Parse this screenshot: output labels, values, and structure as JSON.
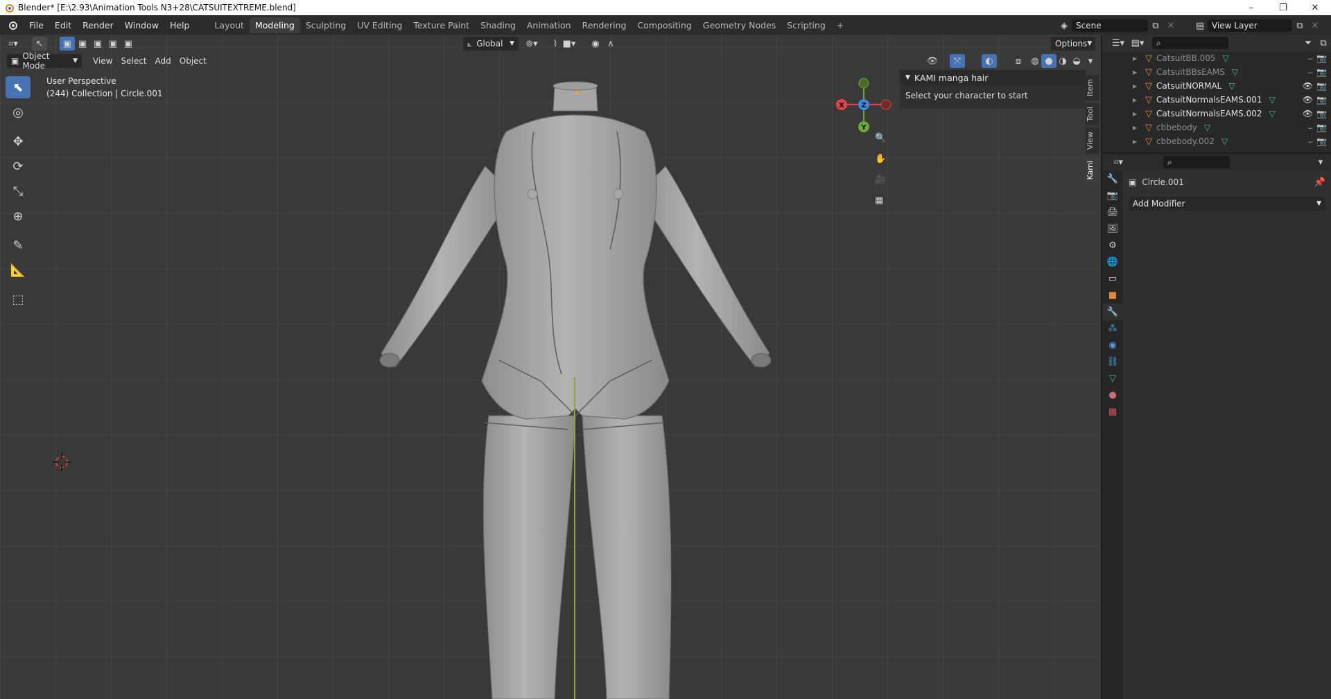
{
  "window": {
    "title": "Blender* [E:\\2.93\\Animation Tools N3+28\\CATSUITEXTREME.blend]",
    "controls": [
      "–",
      "❐",
      "✕"
    ]
  },
  "menu": [
    "File",
    "Edit",
    "Render",
    "Window",
    "Help"
  ],
  "workspaces": [
    {
      "label": "Layout",
      "active": false
    },
    {
      "label": "Modeling",
      "active": true
    },
    {
      "label": "Sculpting",
      "active": false
    },
    {
      "label": "UV Editing",
      "active": false
    },
    {
      "label": "Texture Paint",
      "active": false
    },
    {
      "label": "Shading",
      "active": false
    },
    {
      "label": "Animation",
      "active": false
    },
    {
      "label": "Rendering",
      "active": false
    },
    {
      "label": "Compositing",
      "active": false
    },
    {
      "label": "Geometry Nodes",
      "active": false
    },
    {
      "label": "Scripting",
      "active": false
    }
  ],
  "add_workspace": "+",
  "scene": {
    "label": "Scene"
  },
  "view_layer": {
    "label": "View Layer"
  },
  "viewport_header": {
    "transform_orientation": "Global",
    "options": "Options",
    "mode": "Object Mode",
    "menus": [
      "View",
      "Select",
      "Add",
      "Object"
    ]
  },
  "viewport_info": {
    "line1": "User Perspective",
    "line2": "(244) Collection | Circle.001"
  },
  "gizmo": {
    "x": "X",
    "y": "Y",
    "z": "Z"
  },
  "kami_panel": {
    "title": "KAMI manga hair",
    "body": "Select your character to start"
  },
  "side_tabs": [
    "Item",
    "Tool",
    "View",
    "Kami"
  ],
  "outliner": {
    "rows": [
      {
        "name": "CatsuitBB.005",
        "visible": false
      },
      {
        "name": "CatsuitBBsEAMS",
        "visible": false
      },
      {
        "name": "CatsuitNORMAL",
        "visible": true
      },
      {
        "name": "CatsuitNormalsEAMS.001",
        "visible": true
      },
      {
        "name": "CatsuitNormalsEAMS.002",
        "visible": true
      },
      {
        "name": "cbbebody",
        "visible": false
      },
      {
        "name": "cbbebody.002",
        "visible": false
      }
    ]
  },
  "properties": {
    "object_name": "Circle.001",
    "add_modifier": "Add Modifier"
  },
  "colors": {
    "accent": "#4772b3",
    "axis_x": "#e54343",
    "axis_y": "#6fa832",
    "axis_z": "#3e86e0",
    "mesh_icon": "#e0893a",
    "data_icon": "#45c48a"
  }
}
